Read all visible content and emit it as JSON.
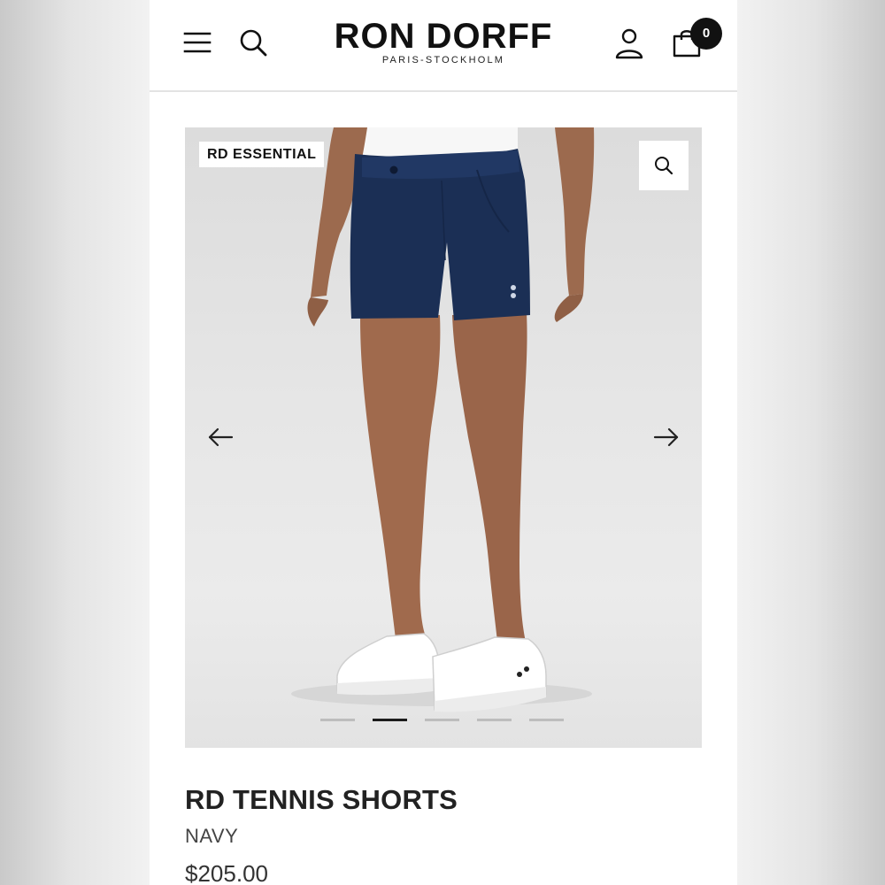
{
  "header": {
    "brand": "RON DORFF",
    "tagline": "PARIS-STOCKHOLM",
    "cart_count": "0",
    "icons": [
      "menu-icon",
      "search-icon",
      "account-icon",
      "cart-icon"
    ]
  },
  "gallery": {
    "badge": "RD ESSENTIAL",
    "icons": [
      "zoom-icon",
      "arrow-left-icon",
      "arrow-right-icon"
    ],
    "slide_count": 5,
    "active_slide": 2
  },
  "product": {
    "title": "RD TENNIS SHORTS",
    "color": "NAVY",
    "price": "$205.00"
  },
  "colors": {
    "shorts_navy": "#1b2f55",
    "text_dark": "#111111",
    "badge_bg": "#ffffff"
  }
}
